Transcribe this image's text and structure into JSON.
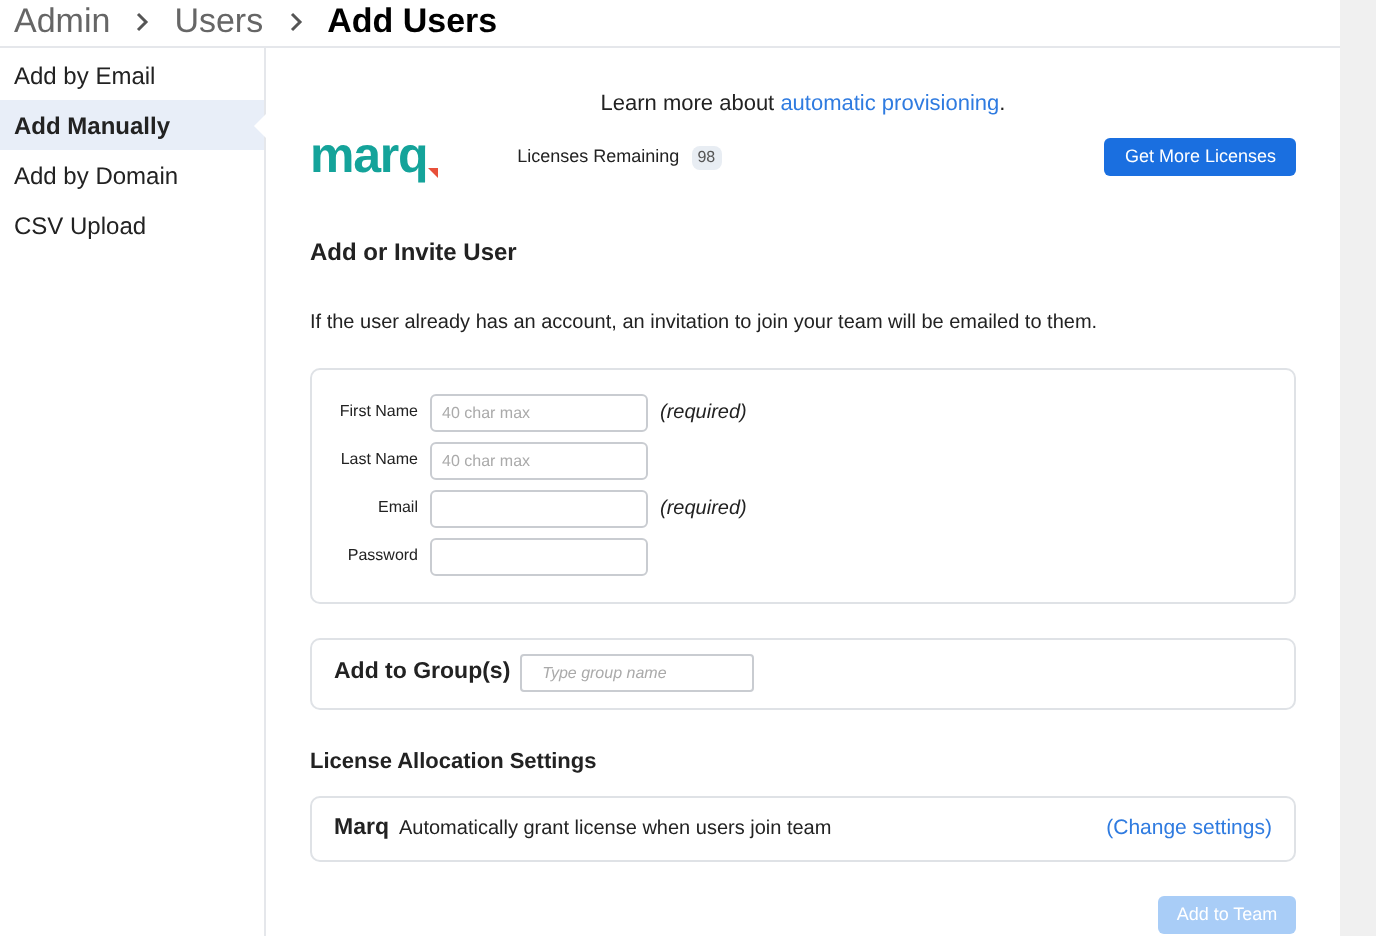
{
  "breadcrumb": [
    {
      "label": "Admin",
      "current": false
    },
    {
      "label": "Users",
      "current": false
    },
    {
      "label": "Add Users",
      "current": true
    }
  ],
  "sidebar": {
    "items": [
      {
        "label": "Add by Email",
        "selected": false
      },
      {
        "label": "Add Manually",
        "selected": true
      },
      {
        "label": "Add by Domain",
        "selected": false
      },
      {
        "label": "CSV Upload",
        "selected": false
      }
    ]
  },
  "banner": {
    "text": "Learn more about",
    "link": "automatic provisioning",
    "end": "."
  },
  "logo": "marq",
  "licenses": {
    "label": "Licenses Remaining",
    "count": "98",
    "button": "Get More Licenses"
  },
  "invite": {
    "title": "Add or Invite User",
    "note": "If the user already has an account, an invitation to join your team will be emailed to them.",
    "fields": [
      {
        "label": "First Name",
        "placeholder": "40 char max",
        "hint": "(required)"
      },
      {
        "label": "Last Name",
        "placeholder": "40 char max"
      },
      {
        "label": "Email",
        "hint": "(required)"
      },
      {
        "label": "Password"
      }
    ]
  },
  "group": {
    "label": "Add to Group(s)",
    "placeholder": "Type group name"
  },
  "allocation": {
    "title": "License Allocation Settings",
    "product": "Marq",
    "text": "Automatically grant license when users join team",
    "link": "(Change settings)"
  },
  "submit": {
    "label": "Add to Team",
    "disabled": true
  }
}
